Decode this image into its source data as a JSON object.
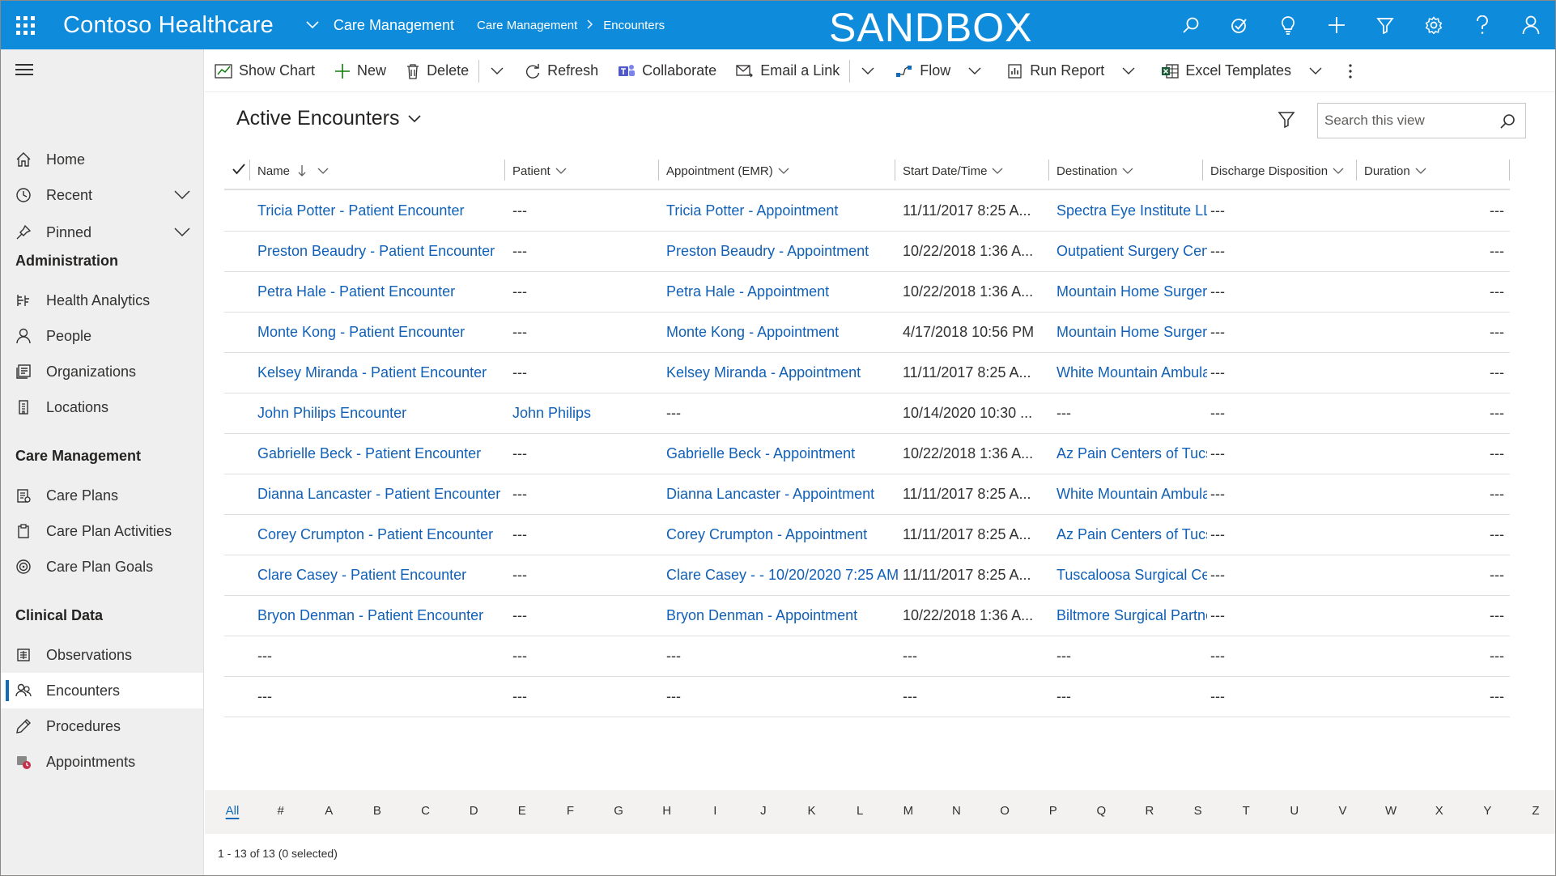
{
  "header": {
    "app_title": "Contoso Healthcare",
    "area_name": "Care Management",
    "breadcrumb": [
      "Care Management",
      "Encounters"
    ],
    "environment_banner": "SANDBOX",
    "icons": [
      "search-icon",
      "task-icon",
      "lightbulb-icon",
      "plus-icon",
      "filter-icon",
      "settings-icon",
      "help-icon",
      "user-icon"
    ],
    "accent_color": "#0f8bdc"
  },
  "sidenav": {
    "top_items": [
      {
        "label": "Home",
        "icon": "home-icon"
      },
      {
        "label": "Recent",
        "icon": "clock-icon"
      },
      {
        "label": "Pinned",
        "icon": "pin-icon"
      }
    ],
    "groups": [
      {
        "title": "Administration",
        "items": [
          {
            "label": "Health Analytics",
            "icon": "analytics-icon"
          },
          {
            "label": "People",
            "icon": "person-icon"
          },
          {
            "label": "Organizations",
            "icon": "organization-icon"
          },
          {
            "label": "Locations",
            "icon": "building-icon"
          }
        ]
      },
      {
        "title": "Care Management",
        "items": [
          {
            "label": "Care Plans",
            "icon": "care-plan-icon"
          },
          {
            "label": "Care Plan Activities",
            "icon": "clipboard-icon"
          },
          {
            "label": "Care Plan Goals",
            "icon": "goal-icon"
          }
        ]
      },
      {
        "title": "Clinical Data",
        "items": [
          {
            "label": "Observations",
            "icon": "observation-icon"
          },
          {
            "label": "Encounters",
            "icon": "people-icon",
            "selected": true
          },
          {
            "label": "Procedures",
            "icon": "pen-icon"
          },
          {
            "label": "Appointments",
            "icon": "appointment-icon"
          }
        ]
      }
    ]
  },
  "commandbar": {
    "show_chart": "Show Chart",
    "new": "New",
    "delete": "Delete",
    "refresh": "Refresh",
    "collaborate": "Collaborate",
    "email_link": "Email a Link",
    "flow": "Flow",
    "run_report": "Run Report",
    "excel_templates": "Excel Templates"
  },
  "view": {
    "title": "Active Encounters",
    "search_placeholder": "Search this view"
  },
  "grid": {
    "columns": [
      "Name",
      "Patient",
      "Appointment (EMR)",
      "Start Date/Time",
      "Destination",
      "Discharge Disposition",
      "Duration"
    ],
    "rows": [
      [
        "Tricia Potter - Patient Encounter",
        "---",
        "Tricia Potter - Appointment",
        "11/11/2017 8:25 A...",
        "Spectra Eye Institute LLC",
        "---",
        "---"
      ],
      [
        "Preston Beaudry - Patient Encounter",
        "---",
        "Preston Beaudry - Appointment",
        "10/22/2018 1:36 A...",
        "Outpatient Surgery Center",
        "---",
        "---"
      ],
      [
        "Petra Hale - Patient Encounter",
        "---",
        "Petra Hale - Appointment",
        "10/22/2018 1:36 A...",
        "Mountain Home Surgery",
        "---",
        "---"
      ],
      [
        "Monte Kong - Patient Encounter",
        "---",
        "Monte Kong - Appointment",
        "4/17/2018 10:56 PM",
        "Mountain Home Surgery",
        "---",
        "---"
      ],
      [
        "Kelsey Miranda - Patient Encounter",
        "---",
        "Kelsey Miranda - Appointment",
        "11/11/2017 8:25 A...",
        "White Mountain Ambulatory",
        "---",
        "---"
      ],
      [
        "John Philips Encounter",
        "John Philips",
        "---",
        "10/14/2020 10:30 ...",
        "---",
        "---",
        "---"
      ],
      [
        "Gabrielle Beck - Patient Encounter",
        "---",
        "Gabrielle Beck - Appointment",
        "10/22/2018 1:36 A...",
        "Az Pain Centers of Tucson",
        "---",
        "---"
      ],
      [
        "Dianna Lancaster - Patient Encounter",
        "---",
        "Dianna Lancaster - Appointment",
        "11/11/2017 8:25 A...",
        "White Mountain Ambulatory",
        "---",
        "---"
      ],
      [
        "Corey Crumpton - Patient Encounter",
        "---",
        "Corey Crumpton - Appointment",
        "11/11/2017 8:25 A...",
        "Az Pain Centers of Tucson",
        "---",
        "---"
      ],
      [
        "Clare Casey - Patient Encounter",
        "---",
        "Clare Casey -  - 10/20/2020 7:25 AM",
        "11/11/2017 8:25 A...",
        "Tuscaloosa Surgical Center",
        "---",
        "---"
      ],
      [
        "Bryon Denman - Patient Encounter",
        "---",
        "Bryon Denman - Appointment",
        "10/22/2018 1:36 A...",
        "Biltmore Surgical Partners",
        "---",
        "---"
      ],
      [
        "---",
        "---",
        "---",
        "---",
        "---",
        "---",
        "---"
      ],
      [
        "---",
        "---",
        "---",
        "---",
        "---",
        "---",
        "---"
      ]
    ]
  },
  "jumpbar": {
    "letters": [
      "All",
      "#",
      "A",
      "B",
      "C",
      "D",
      "E",
      "F",
      "G",
      "H",
      "I",
      "J",
      "K",
      "L",
      "M",
      "N",
      "O",
      "P",
      "Q",
      "R",
      "S",
      "T",
      "U",
      "V",
      "W",
      "X",
      "Y",
      "Z"
    ],
    "active": "All"
  },
  "status": {
    "record_count": "1 - 13 of 13 (0 selected)"
  }
}
